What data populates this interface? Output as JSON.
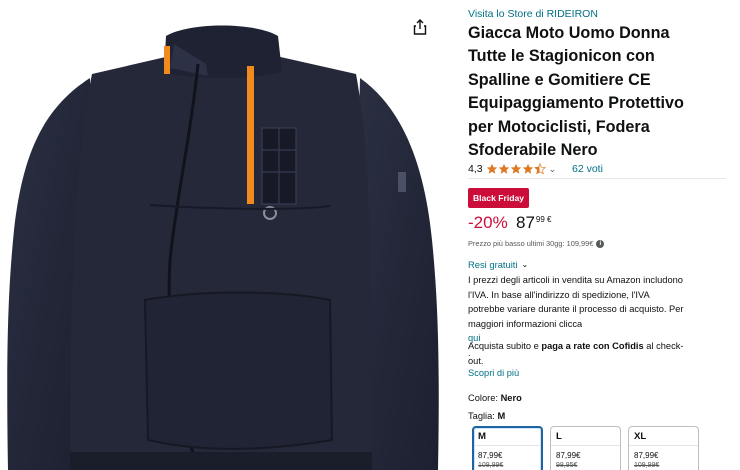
{
  "store": {
    "link_text": "Visita lo Store di RIDEIRON"
  },
  "product": {
    "title_lines": [
      "Giacca Moto Uomo Donna",
      "Tutte le Stagionicon con",
      "Spalline e Gomitiere CE",
      "Equipaggiamento Protettivo",
      "per Motociclisti, Fodera",
      "Sfoderabile Nero"
    ],
    "image_alt": "giacca nera con zip arancione",
    "share_icon": "share-icon"
  },
  "rating": {
    "value": "4,3",
    "stars_value": 4.3,
    "count": "62 voti",
    "chevron": "⌄"
  },
  "deal": {
    "badge": "Black Friday",
    "discount": "-20%",
    "price_whole": "87",
    "price_fraction": "99 €",
    "lowest_price": "Prezzo più basso ultimi 30gg: 109,99€"
  },
  "returns": {
    "label": "Resi gratuiti",
    "vat_lines": [
      "I prezzi degli articoli in vendita su Amazon includono",
      "l'IVA. In base all'indirizzo di spedizione, l'IVA",
      "potrebbe variare durante il processo di acquisto. Per"
    ],
    "vat_last_prefix": "maggiori informazioni clicca ",
    "vat_link": "qui",
    "vat_last_suffix": "."
  },
  "installments": {
    "prefix": "Acquista subito e ",
    "bold": "paga a rate con Cofidis",
    "suffix": " al check-",
    "line2": "out.",
    "more_link": "Scopri di più"
  },
  "variation": {
    "color_label": "Colore: ",
    "color_value": "Nero",
    "size_label": "Taglia: ",
    "size_value": "M",
    "sizes": [
      {
        "label": "M",
        "price": "87,99€",
        "old_price": "109,99€",
        "selected": true
      },
      {
        "label": "L",
        "price": "87,99€",
        "old_price": "98,95€",
        "selected": false
      },
      {
        "label": "XL",
        "price": "87,99€",
        "old_price": "109,99€",
        "selected": false
      }
    ]
  },
  "colors": {
    "link": "#007185",
    "deal_red": "#cc0c39",
    "star": "#de7921",
    "jacket": "#242838",
    "zip_accent": "#f28a1e",
    "selected_border": "#2162a1"
  }
}
